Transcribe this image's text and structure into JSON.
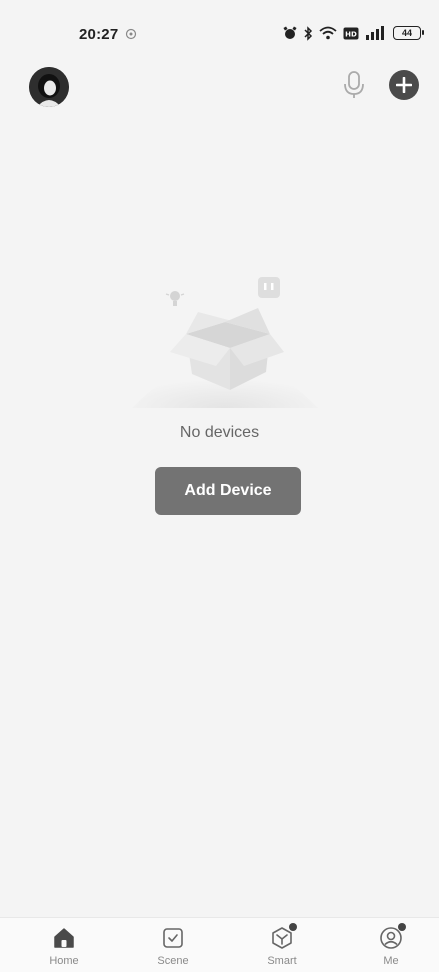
{
  "status_bar": {
    "time": "20:27",
    "battery": "44"
  },
  "header": {
    "avatar_icon": "user-avatar-icon",
    "mic_icon": "microphone-icon",
    "add_icon": "plus-icon"
  },
  "empty_state": {
    "message": "No devices",
    "button_label": "Add Device",
    "illustration_icon": "empty-box-icon"
  },
  "bottom_nav": {
    "items": [
      {
        "label": "Home",
        "icon": "home-icon"
      },
      {
        "label": "Scene",
        "icon": "scene-icon"
      },
      {
        "label": "Smart",
        "icon": "smart-icon"
      },
      {
        "label": "Me",
        "icon": "profile-icon"
      }
    ]
  },
  "colors": {
    "background": "#f4f4f4",
    "button": "#737373",
    "icon_dark": "#4a4a4a"
  }
}
